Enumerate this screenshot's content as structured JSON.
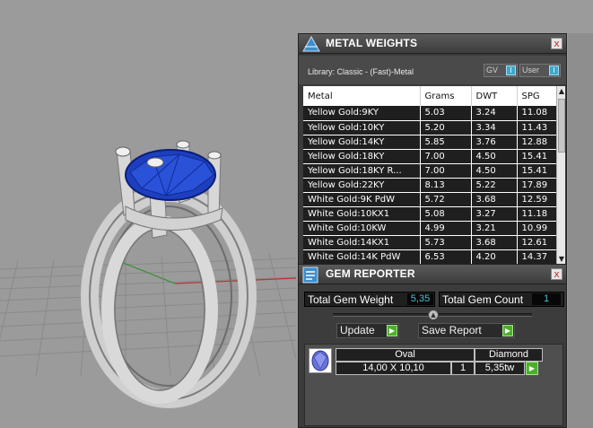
{
  "metal_weights": {
    "title": "METAL WEIGHTS",
    "close_label": "x",
    "library_text": "Library: Classic - (Fast)-Metal",
    "toggle_gv_label": "GV",
    "toggle_user_label": "User",
    "toggle_knob_glyph": "I",
    "columns": [
      "Metal",
      "Grams",
      "DWT",
      "SPG"
    ],
    "rows": [
      [
        "Yellow Gold:9KY",
        "5.03",
        "3.24",
        "11.08"
      ],
      [
        "Yellow Gold:10KY",
        "5.20",
        "3.34",
        "11.43"
      ],
      [
        "Yellow Gold:14KY",
        "5.85",
        "3.76",
        "12.88"
      ],
      [
        "Yellow Gold:18KY",
        "7.00",
        "4.50",
        "15.41"
      ],
      [
        "Yellow Gold:18KY R...",
        "7.00",
        "4.50",
        "15.41"
      ],
      [
        "Yellow Gold:22KY",
        "8.13",
        "5.22",
        "17.89"
      ],
      [
        "White Gold:9K PdW",
        "5.72",
        "3.68",
        "12.59"
      ],
      [
        "White Gold:10KX1",
        "5.08",
        "3.27",
        "11.18"
      ],
      [
        "White Gold:10KW",
        "4.99",
        "3.21",
        "10.99"
      ],
      [
        "White Gold:14KX1",
        "5.73",
        "3.68",
        "12.61"
      ],
      [
        "White Gold:14K PdW",
        "6.53",
        "4.20",
        "14.37"
      ]
    ],
    "scroll_up_glyph": "▲",
    "scroll_down_glyph": "▼"
  },
  "gem_reporter": {
    "title": "GEM REPORTER",
    "close_label": "x",
    "total_weight_label": "Total Gem Weight",
    "total_weight_value": "5,35",
    "total_count_label": "Total Gem Count",
    "total_count_value": "1",
    "update_label": "Update",
    "save_report_label": "Save Report",
    "go_glyph": "▶",
    "slider_glyph": "▲",
    "gem": {
      "shape": "Oval",
      "material": "Diamond",
      "size": "14,00 X 10,10",
      "qty": "1",
      "weight": "5,35tw"
    }
  },
  "colors": {
    "stone_blue": "#1d3fbf",
    "metal_grey": "#c8c8c8",
    "accent_cyan": "#46c7d8",
    "go_green": "#4caf2c"
  },
  "icons": [
    "metal-weights-icon",
    "gem-reporter-icon",
    "close-icon",
    "go-arrow-icon",
    "gem-thumbnail-icon"
  ]
}
